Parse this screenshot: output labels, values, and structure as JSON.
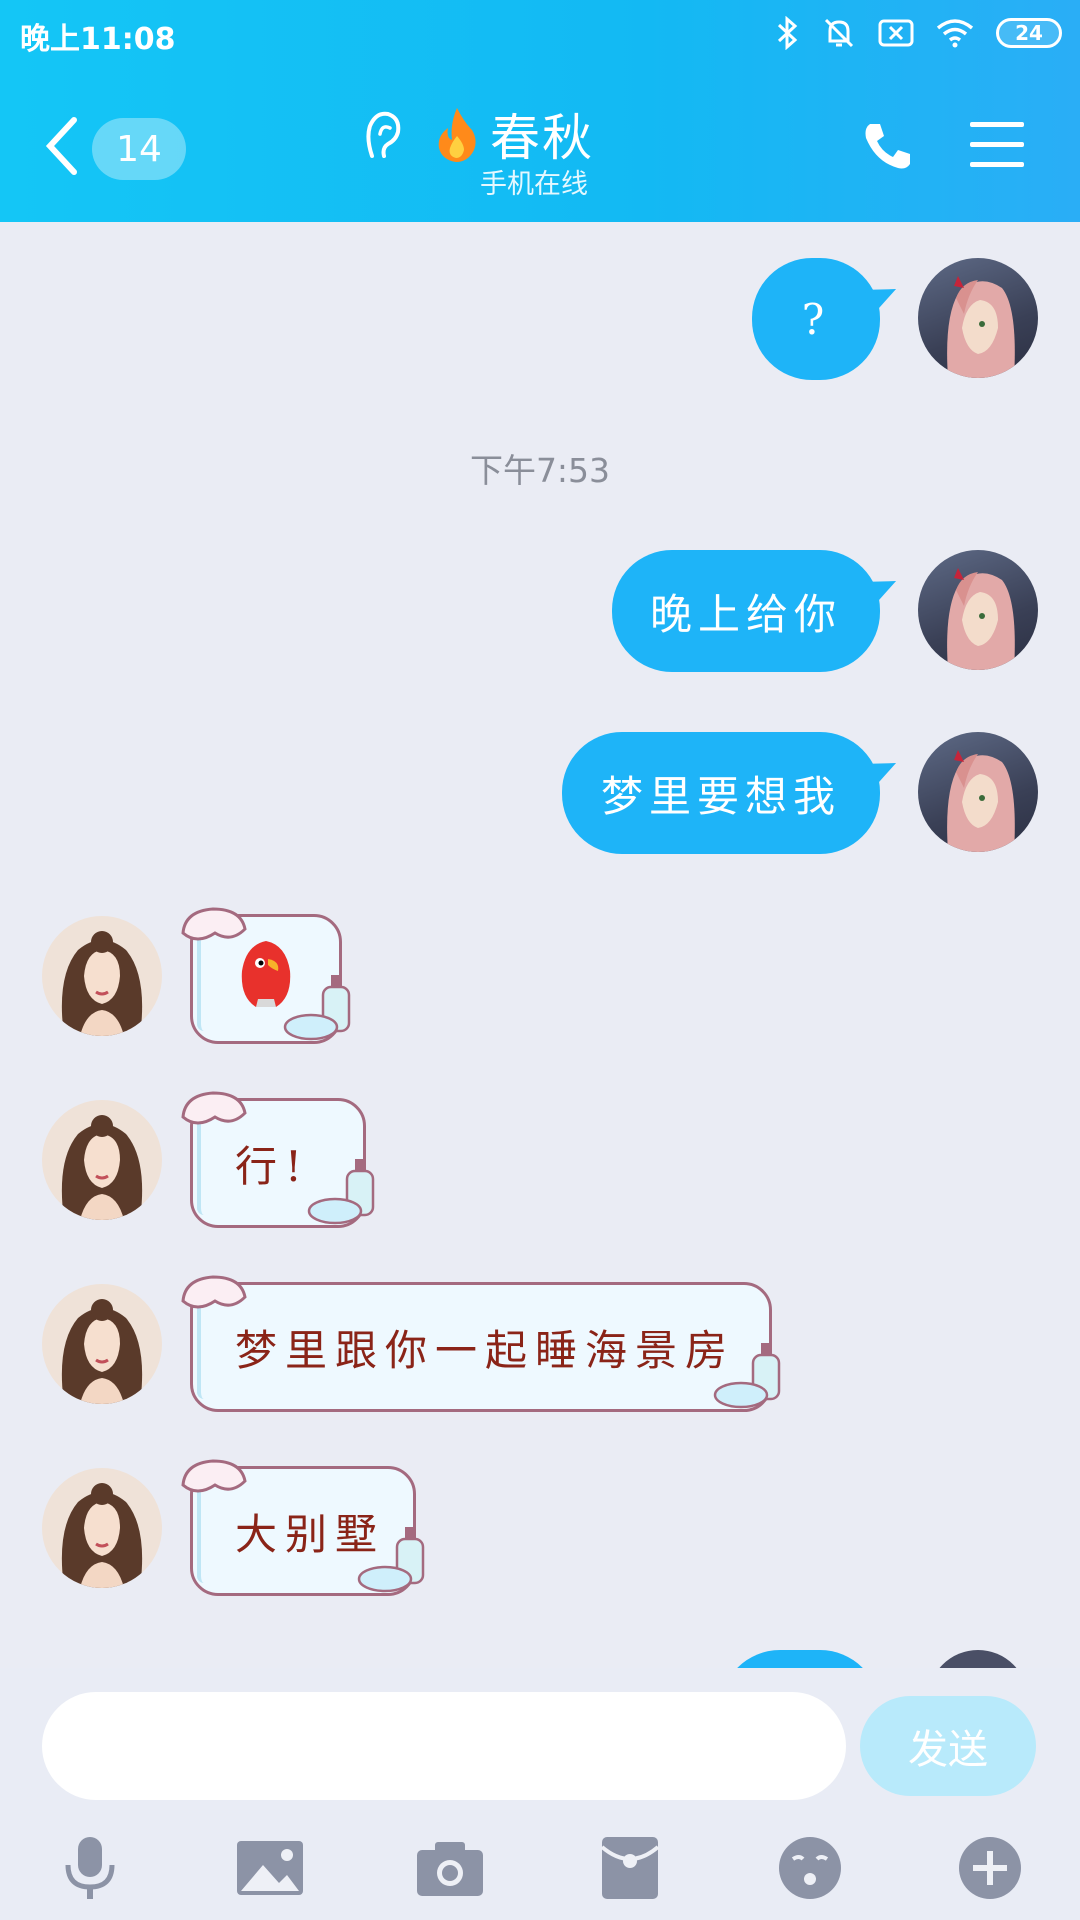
{
  "status_bar": {
    "time": "晚上11:08",
    "battery": "24",
    "icons": [
      "bluetooth-icon",
      "mute-bell-icon",
      "sim-x-icon",
      "wifi-icon",
      "battery-icon"
    ]
  },
  "header": {
    "unread_count": "14",
    "contact_name": "春秋",
    "contact_status": "手机在线",
    "colors": {
      "start": "#14c6f6",
      "end": "#2aaef6"
    }
  },
  "messages": [
    {
      "from": "me",
      "text": "?"
    },
    {
      "type": "timestamp",
      "text": "下午7:53"
    },
    {
      "from": "me",
      "text": "晚上给你"
    },
    {
      "from": "me",
      "text": "梦里要想我"
    },
    {
      "from": "them",
      "type": "sticker",
      "text": ""
    },
    {
      "from": "them",
      "text": "行!"
    },
    {
      "from": "them",
      "text": "梦里跟你一起睡海景房"
    },
    {
      "from": "them",
      "text": "大别墅"
    }
  ],
  "input": {
    "value": "",
    "send_label": "发送"
  },
  "toolbar": [
    "microphone-icon",
    "image-icon",
    "camera-icon",
    "red-packet-icon",
    "emoji-icon",
    "plus-icon"
  ],
  "colors": {
    "my_bubble": "#1eb4f8",
    "their_text": "#8a2418",
    "background": "#eaecf4"
  }
}
